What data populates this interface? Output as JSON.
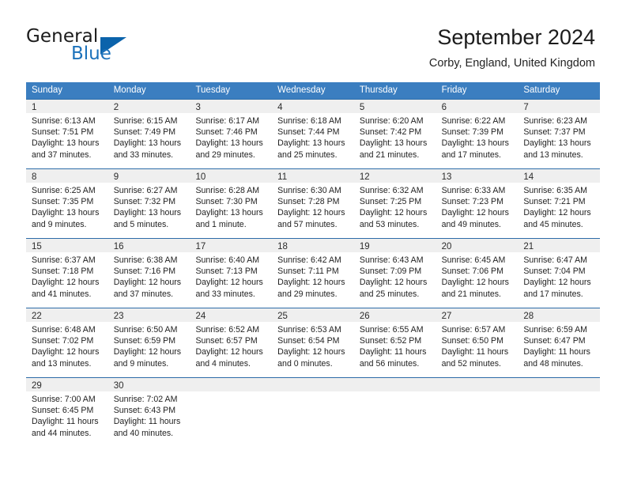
{
  "brand": {
    "name_part1": "General",
    "name_part2": "Blue",
    "triangle_color": "#0b63ab",
    "blue_text_color": "#1c72bb"
  },
  "header": {
    "title": "September 2024",
    "subtitle": "Corby, England, United Kingdom"
  },
  "theme": {
    "header_blue": "#3b7ec0",
    "row_divider_blue": "#2d6ca8",
    "date_band_gray": "#efefef"
  },
  "weekdays": [
    "Sunday",
    "Monday",
    "Tuesday",
    "Wednesday",
    "Thursday",
    "Friday",
    "Saturday"
  ],
  "weeks": [
    [
      {
        "day": "1",
        "sunrise": "Sunrise: 6:13 AM",
        "sunset": "Sunset: 7:51 PM",
        "daylight_line1": "Daylight: 13 hours",
        "daylight_line2": "and 37 minutes."
      },
      {
        "day": "2",
        "sunrise": "Sunrise: 6:15 AM",
        "sunset": "Sunset: 7:49 PM",
        "daylight_line1": "Daylight: 13 hours",
        "daylight_line2": "and 33 minutes."
      },
      {
        "day": "3",
        "sunrise": "Sunrise: 6:17 AM",
        "sunset": "Sunset: 7:46 PM",
        "daylight_line1": "Daylight: 13 hours",
        "daylight_line2": "and 29 minutes."
      },
      {
        "day": "4",
        "sunrise": "Sunrise: 6:18 AM",
        "sunset": "Sunset: 7:44 PM",
        "daylight_line1": "Daylight: 13 hours",
        "daylight_line2": "and 25 minutes."
      },
      {
        "day": "5",
        "sunrise": "Sunrise: 6:20 AM",
        "sunset": "Sunset: 7:42 PM",
        "daylight_line1": "Daylight: 13 hours",
        "daylight_line2": "and 21 minutes."
      },
      {
        "day": "6",
        "sunrise": "Sunrise: 6:22 AM",
        "sunset": "Sunset: 7:39 PM",
        "daylight_line1": "Daylight: 13 hours",
        "daylight_line2": "and 17 minutes."
      },
      {
        "day": "7",
        "sunrise": "Sunrise: 6:23 AM",
        "sunset": "Sunset: 7:37 PM",
        "daylight_line1": "Daylight: 13 hours",
        "daylight_line2": "and 13 minutes."
      }
    ],
    [
      {
        "day": "8",
        "sunrise": "Sunrise: 6:25 AM",
        "sunset": "Sunset: 7:35 PM",
        "daylight_line1": "Daylight: 13 hours",
        "daylight_line2": "and 9 minutes."
      },
      {
        "day": "9",
        "sunrise": "Sunrise: 6:27 AM",
        "sunset": "Sunset: 7:32 PM",
        "daylight_line1": "Daylight: 13 hours",
        "daylight_line2": "and 5 minutes."
      },
      {
        "day": "10",
        "sunrise": "Sunrise: 6:28 AM",
        "sunset": "Sunset: 7:30 PM",
        "daylight_line1": "Daylight: 13 hours",
        "daylight_line2": "and 1 minute."
      },
      {
        "day": "11",
        "sunrise": "Sunrise: 6:30 AM",
        "sunset": "Sunset: 7:28 PM",
        "daylight_line1": "Daylight: 12 hours",
        "daylight_line2": "and 57 minutes."
      },
      {
        "day": "12",
        "sunrise": "Sunrise: 6:32 AM",
        "sunset": "Sunset: 7:25 PM",
        "daylight_line1": "Daylight: 12 hours",
        "daylight_line2": "and 53 minutes."
      },
      {
        "day": "13",
        "sunrise": "Sunrise: 6:33 AM",
        "sunset": "Sunset: 7:23 PM",
        "daylight_line1": "Daylight: 12 hours",
        "daylight_line2": "and 49 minutes."
      },
      {
        "day": "14",
        "sunrise": "Sunrise: 6:35 AM",
        "sunset": "Sunset: 7:21 PM",
        "daylight_line1": "Daylight: 12 hours",
        "daylight_line2": "and 45 minutes."
      }
    ],
    [
      {
        "day": "15",
        "sunrise": "Sunrise: 6:37 AM",
        "sunset": "Sunset: 7:18 PM",
        "daylight_line1": "Daylight: 12 hours",
        "daylight_line2": "and 41 minutes."
      },
      {
        "day": "16",
        "sunrise": "Sunrise: 6:38 AM",
        "sunset": "Sunset: 7:16 PM",
        "daylight_line1": "Daylight: 12 hours",
        "daylight_line2": "and 37 minutes."
      },
      {
        "day": "17",
        "sunrise": "Sunrise: 6:40 AM",
        "sunset": "Sunset: 7:13 PM",
        "daylight_line1": "Daylight: 12 hours",
        "daylight_line2": "and 33 minutes."
      },
      {
        "day": "18",
        "sunrise": "Sunrise: 6:42 AM",
        "sunset": "Sunset: 7:11 PM",
        "daylight_line1": "Daylight: 12 hours",
        "daylight_line2": "and 29 minutes."
      },
      {
        "day": "19",
        "sunrise": "Sunrise: 6:43 AM",
        "sunset": "Sunset: 7:09 PM",
        "daylight_line1": "Daylight: 12 hours",
        "daylight_line2": "and 25 minutes."
      },
      {
        "day": "20",
        "sunrise": "Sunrise: 6:45 AM",
        "sunset": "Sunset: 7:06 PM",
        "daylight_line1": "Daylight: 12 hours",
        "daylight_line2": "and 21 minutes."
      },
      {
        "day": "21",
        "sunrise": "Sunrise: 6:47 AM",
        "sunset": "Sunset: 7:04 PM",
        "daylight_line1": "Daylight: 12 hours",
        "daylight_line2": "and 17 minutes."
      }
    ],
    [
      {
        "day": "22",
        "sunrise": "Sunrise: 6:48 AM",
        "sunset": "Sunset: 7:02 PM",
        "daylight_line1": "Daylight: 12 hours",
        "daylight_line2": "and 13 minutes."
      },
      {
        "day": "23",
        "sunrise": "Sunrise: 6:50 AM",
        "sunset": "Sunset: 6:59 PM",
        "daylight_line1": "Daylight: 12 hours",
        "daylight_line2": "and 9 minutes."
      },
      {
        "day": "24",
        "sunrise": "Sunrise: 6:52 AM",
        "sunset": "Sunset: 6:57 PM",
        "daylight_line1": "Daylight: 12 hours",
        "daylight_line2": "and 4 minutes."
      },
      {
        "day": "25",
        "sunrise": "Sunrise: 6:53 AM",
        "sunset": "Sunset: 6:54 PM",
        "daylight_line1": "Daylight: 12 hours",
        "daylight_line2": "and 0 minutes."
      },
      {
        "day": "26",
        "sunrise": "Sunrise: 6:55 AM",
        "sunset": "Sunset: 6:52 PM",
        "daylight_line1": "Daylight: 11 hours",
        "daylight_line2": "and 56 minutes."
      },
      {
        "day": "27",
        "sunrise": "Sunrise: 6:57 AM",
        "sunset": "Sunset: 6:50 PM",
        "daylight_line1": "Daylight: 11 hours",
        "daylight_line2": "and 52 minutes."
      },
      {
        "day": "28",
        "sunrise": "Sunrise: 6:59 AM",
        "sunset": "Sunset: 6:47 PM",
        "daylight_line1": "Daylight: 11 hours",
        "daylight_line2": "and 48 minutes."
      }
    ],
    [
      {
        "day": "29",
        "sunrise": "Sunrise: 7:00 AM",
        "sunset": "Sunset: 6:45 PM",
        "daylight_line1": "Daylight: 11 hours",
        "daylight_line2": "and 44 minutes."
      },
      {
        "day": "30",
        "sunrise": "Sunrise: 7:02 AM",
        "sunset": "Sunset: 6:43 PM",
        "daylight_line1": "Daylight: 11 hours",
        "daylight_line2": "and 40 minutes."
      },
      {
        "day": "",
        "sunrise": "",
        "sunset": "",
        "daylight_line1": "",
        "daylight_line2": ""
      },
      {
        "day": "",
        "sunrise": "",
        "sunset": "",
        "daylight_line1": "",
        "daylight_line2": ""
      },
      {
        "day": "",
        "sunrise": "",
        "sunset": "",
        "daylight_line1": "",
        "daylight_line2": ""
      },
      {
        "day": "",
        "sunrise": "",
        "sunset": "",
        "daylight_line1": "",
        "daylight_line2": ""
      },
      {
        "day": "",
        "sunrise": "",
        "sunset": "",
        "daylight_line1": "",
        "daylight_line2": ""
      }
    ]
  ]
}
